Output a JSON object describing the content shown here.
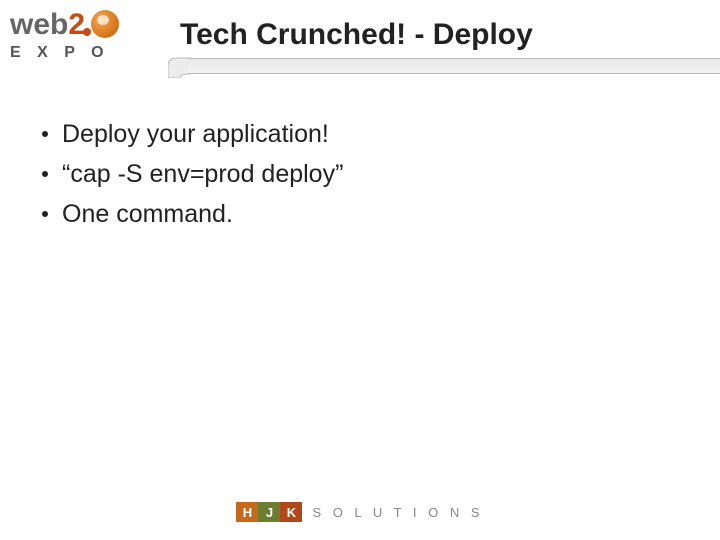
{
  "logo": {
    "web": "web",
    "two": "2",
    "expo": "E X P O"
  },
  "title": "Tech Crunched! - Deploy",
  "bullets": [
    "Deploy your application!",
    "“cap -S env=prod deploy”",
    "One command."
  ],
  "footer": {
    "h": "H",
    "j": "J",
    "k": "K",
    "solutions": "S O L U T I O N S"
  }
}
